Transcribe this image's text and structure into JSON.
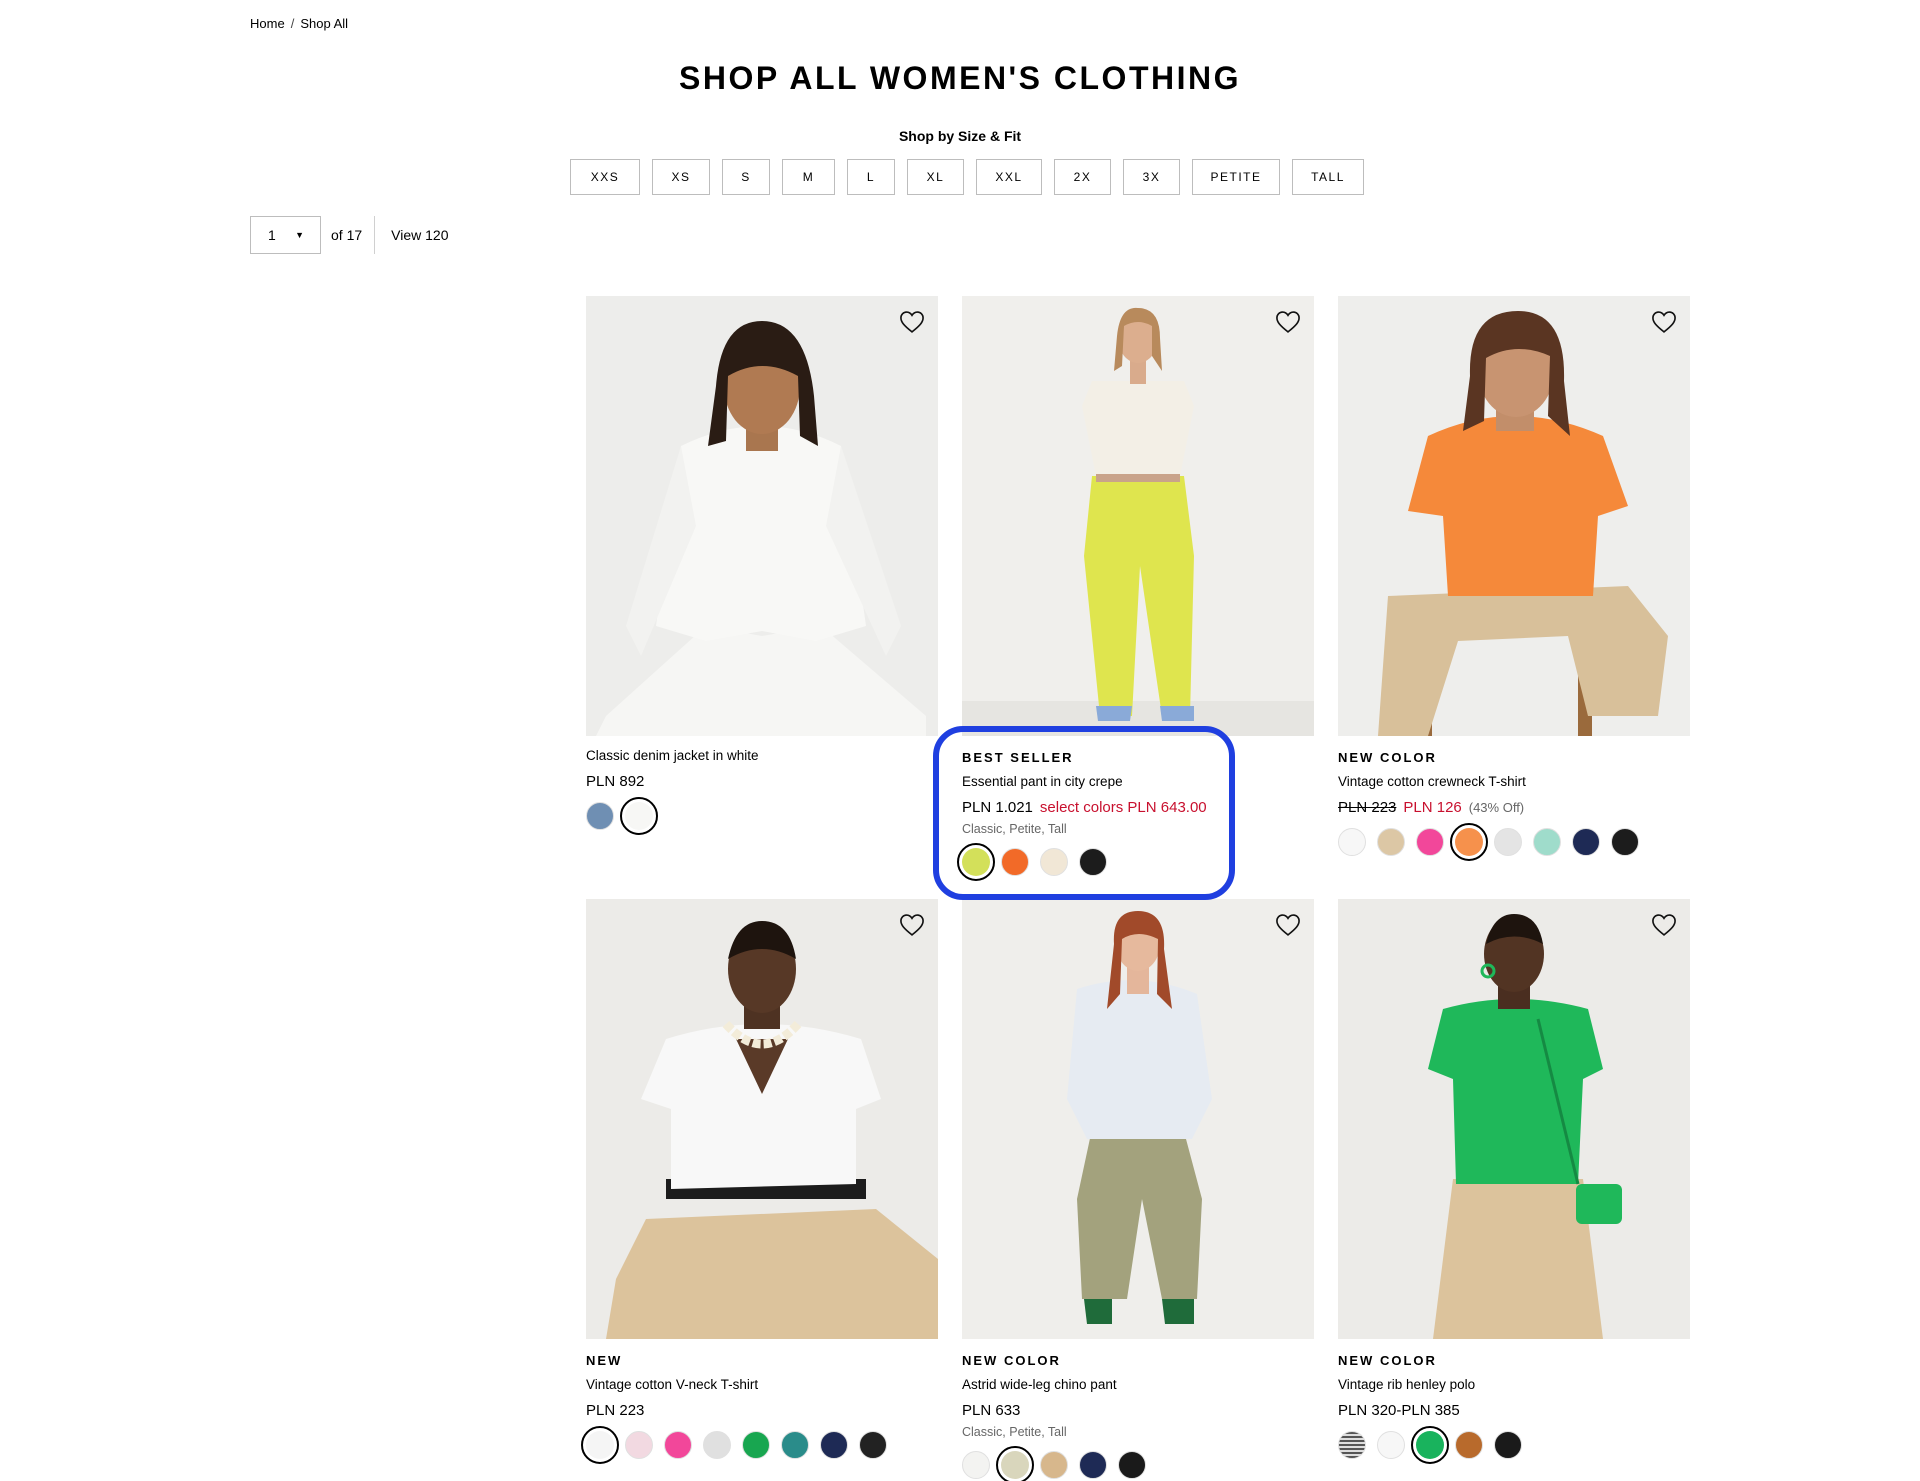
{
  "breadcrumb": {
    "home": "Home",
    "separator": "/",
    "current": "Shop All"
  },
  "page_title": "SHOP ALL WOMEN'S CLOTHING",
  "size_filter": {
    "heading": "Shop by Size & Fit",
    "sizes": [
      "XXS",
      "XS",
      "S",
      "M",
      "L",
      "XL",
      "XXL",
      "2X",
      "3X",
      "PETITE",
      "TALL"
    ]
  },
  "pagination": {
    "current_page": "1",
    "of_total": "of 17",
    "view_all": "View 120"
  },
  "icons": {
    "wishlist": "heart-outline-icon",
    "page_dropdown": "caret-down-icon"
  },
  "highlight_color": "#1f3fe0",
  "products": [
    {
      "badge": "",
      "name": "Classic denim jacket in white",
      "price": "PLN 892",
      "price_old": "",
      "price_sale": "",
      "price_off": "",
      "fits": "",
      "swatches": [
        {
          "color": "#6f8fb3",
          "selected": false
        },
        {
          "color": "#f7f7f5",
          "selected": true
        }
      ]
    },
    {
      "badge": "BEST SELLER",
      "name": "Essential pant in city crepe",
      "price": "PLN 1.021",
      "price_old": "",
      "price_sale": "select colors PLN 643.00",
      "price_off": "",
      "fits": "Classic, Petite, Tall",
      "swatches": [
        {
          "color": "#d3e05a",
          "selected": true
        },
        {
          "color": "#f26a28",
          "selected": false
        },
        {
          "color": "#f1e7d6",
          "selected": false
        },
        {
          "color": "#1c1c1c",
          "selected": false
        }
      ]
    },
    {
      "badge": "NEW COLOR",
      "name": "Vintage cotton crewneck T-shirt",
      "price": "",
      "price_old": "PLN 223",
      "price_sale": "PLN 126",
      "price_off": "(43% Off)",
      "fits": "",
      "swatches": [
        {
          "color": "#f7f7f7",
          "selected": false
        },
        {
          "color": "#dcc7a5",
          "selected": false
        },
        {
          "color": "#f2479a",
          "selected": false
        },
        {
          "color": "#f6914c",
          "selected": true
        },
        {
          "color": "#e4e4e4",
          "selected": false
        },
        {
          "color": "#9fdccb",
          "selected": false
        },
        {
          "color": "#1e2a55",
          "selected": false
        },
        {
          "color": "#1c1c1c",
          "selected": false
        }
      ]
    },
    {
      "badge": "NEW",
      "name": "Vintage cotton V-neck T-shirt",
      "price": "PLN 223",
      "price_old": "",
      "price_sale": "",
      "price_off": "",
      "fits": "",
      "swatches": [
        {
          "color": "#f5f5f5",
          "selected": true
        },
        {
          "color": "#f2d9e1",
          "selected": false
        },
        {
          "color": "#f2479a",
          "selected": false
        },
        {
          "color": "#e0e0e0",
          "selected": false
        },
        {
          "color": "#18a650",
          "selected": false
        },
        {
          "color": "#2a8c8a",
          "selected": false
        },
        {
          "color": "#1e2a55",
          "selected": false
        },
        {
          "color": "#222222",
          "selected": false
        }
      ]
    },
    {
      "badge": "NEW COLOR",
      "name": "Astrid wide-leg chino pant",
      "price": "PLN 633",
      "price_old": "",
      "price_sale": "",
      "price_off": "",
      "fits": "Classic, Petite, Tall",
      "swatches": [
        {
          "color": "#f3f3f1",
          "selected": false
        },
        {
          "color": "#d9d6bc",
          "selected": true
        },
        {
          "color": "#d7b78c",
          "selected": false
        },
        {
          "color": "#1e2a55",
          "selected": false
        },
        {
          "color": "#1a1a1a",
          "selected": false
        }
      ]
    },
    {
      "badge": "NEW COLOR",
      "name": "Vintage rib henley polo",
      "price": "PLN 320-PLN 385",
      "price_old": "",
      "price_sale": "",
      "price_off": "",
      "fits": "",
      "swatches": [
        {
          "color": "#8a8a8a",
          "selected": false
        },
        {
          "color": "#f7f7f7",
          "selected": false
        },
        {
          "color": "#19b35d",
          "selected": true
        },
        {
          "color": "#b86a2c",
          "selected": false
        },
        {
          "color": "#1a1a1a",
          "selected": false
        }
      ]
    }
  ]
}
